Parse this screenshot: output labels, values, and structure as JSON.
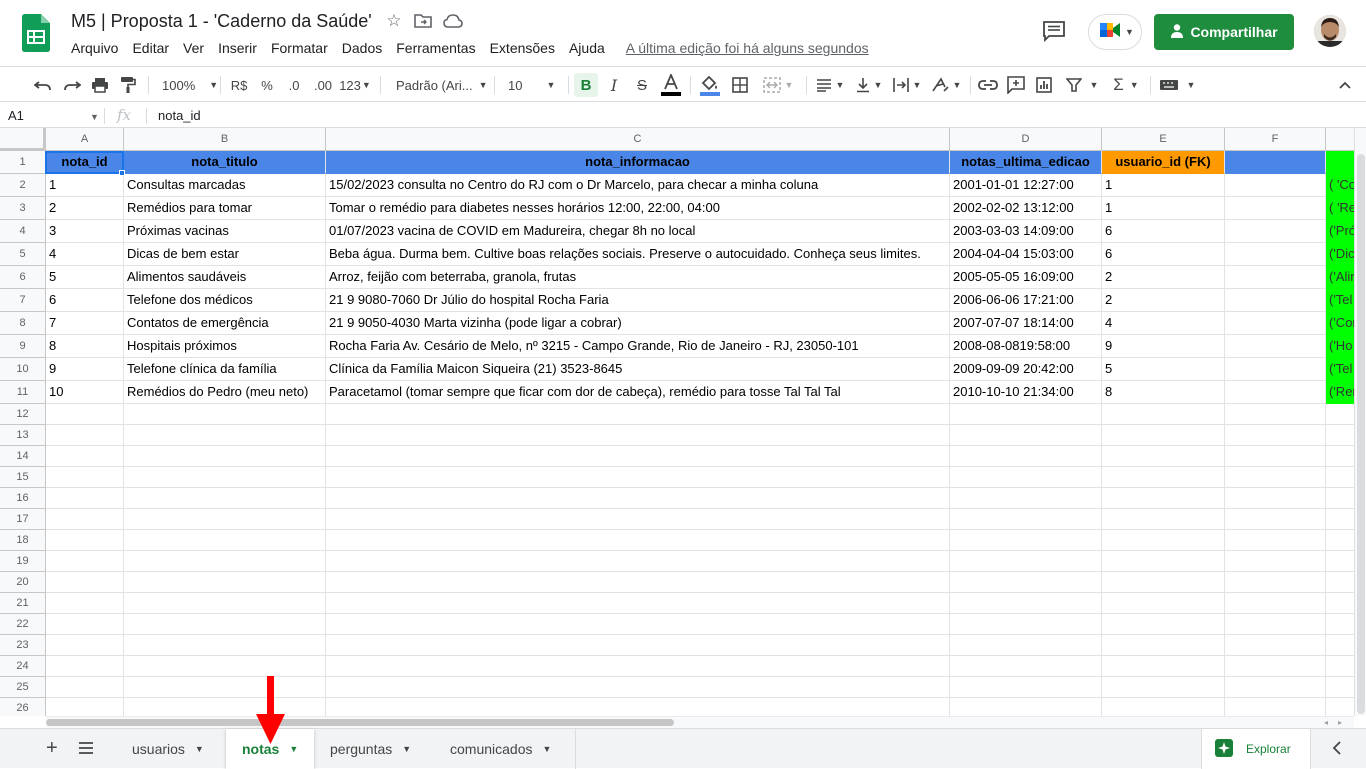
{
  "header": {
    "doc_title": "M5 | Proposta 1 - 'Caderno da Saúde'",
    "menu": [
      "Arquivo",
      "Editar",
      "Ver",
      "Inserir",
      "Formatar",
      "Dados",
      "Ferramentas",
      "Extensões",
      "Ajuda"
    ],
    "last_edit": "A última edição foi há alguns segundos",
    "share_label": "Compartilhar",
    "brand_color": "#1e8e3e"
  },
  "toolbar": {
    "zoom": "100%",
    "currency": "R$",
    "percent": "%",
    "decrease_decimals": ".0",
    "increase_decimals": ".00",
    "more_formats": "123",
    "font": "Padrão (Ari...",
    "font_size": "10"
  },
  "formula_bar": {
    "cell_ref": "A1",
    "fx": "fx",
    "value": "nota_id"
  },
  "grid": {
    "columns": [
      "A",
      "B",
      "C",
      "D",
      "E",
      "F"
    ],
    "rows": [
      "1",
      "2",
      "3",
      "4",
      "5",
      "6",
      "7",
      "8",
      "9",
      "10",
      "11",
      "12",
      "13",
      "14",
      "15",
      "16",
      "17",
      "18",
      "19",
      "20",
      "21",
      "22",
      "23",
      "24",
      "25",
      "26"
    ],
    "header_row": [
      "nota_id",
      "nota_titulo",
      "nota_informacao",
      "notas_ultima_edicao",
      "usuario_id (FK)",
      ""
    ],
    "data": [
      [
        "1",
        "Consultas marcadas",
        "15/02/2023 consulta no Centro do RJ com o Dr Marcelo, para checar a minha coluna",
        "2001-01-01 12:27:00",
        "1",
        "",
        "( 'Co"
      ],
      [
        "2",
        "Remédios para tomar",
        "Tomar o remédio para diabetes nesses horários 12:00, 22:00, 04:00",
        "2002-02-02 13:12:00",
        "1",
        "",
        "( 'Re"
      ],
      [
        "3",
        "Próximas vacinas",
        "01/07/2023 vacina de COVID em Madureira, chegar 8h no local",
        "2003-03-03 14:09:00",
        "6",
        "",
        "('Pró"
      ],
      [
        "4",
        "Dicas de bem estar",
        "Beba água. Durma bem. Cultive boas relações sociais. Preserve o autocuidado. Conheça seus limites.",
        "2004-04-04 15:03:00",
        "6",
        "",
        "('Dic"
      ],
      [
        "5",
        "Alimentos saudáveis",
        "Arroz, feijão com beterraba, granola, frutas",
        "2005-05-05 16:09:00",
        "2",
        "",
        "('Alir"
      ],
      [
        "6",
        "Telefone dos médicos",
        "21 9 9080-7060 Dr Júlio do hospital Rocha Faria",
        "2006-06-06 17:21:00",
        "2",
        "",
        "('Tel"
      ],
      [
        "7",
        "Contatos de emergência",
        "21 9 9050-4030 Marta vizinha (pode ligar a cobrar)",
        "2007-07-07 18:14:00",
        "4",
        "",
        "('Cor"
      ],
      [
        "8",
        "Hospitais próximos",
        "Rocha Faria Av. Cesário de Melo, nº 3215 - Campo Grande, Rio de Janeiro - RJ, 23050-101",
        "2008-08-0819:58:00",
        "9",
        "",
        "('Ho"
      ],
      [
        "9",
        "Telefone clínica da família",
        "Clínica da Família Maicon Siqueira (21) 3523-8645",
        "2009-09-09 20:42:00",
        "5",
        "",
        "('Tel"
      ],
      [
        "10",
        "Remédios do Pedro (meu neto)",
        "Paracetamol (tomar sempre que ficar com dor de cabeça), remédio para tosse Tal Tal Tal",
        "2010-10-10 21:34:00",
        "8",
        "",
        "('Rer"
      ]
    ],
    "colors": {
      "header_blue": "#4a86e8",
      "header_orange": "#ff9900",
      "column_green": "#00ff00",
      "selection": "#1a73e8"
    }
  },
  "sheets": {
    "tabs": [
      "usuarios",
      "notas",
      "perguntas",
      "comunicados"
    ],
    "active": "notas",
    "explore_label": "Explorar"
  }
}
